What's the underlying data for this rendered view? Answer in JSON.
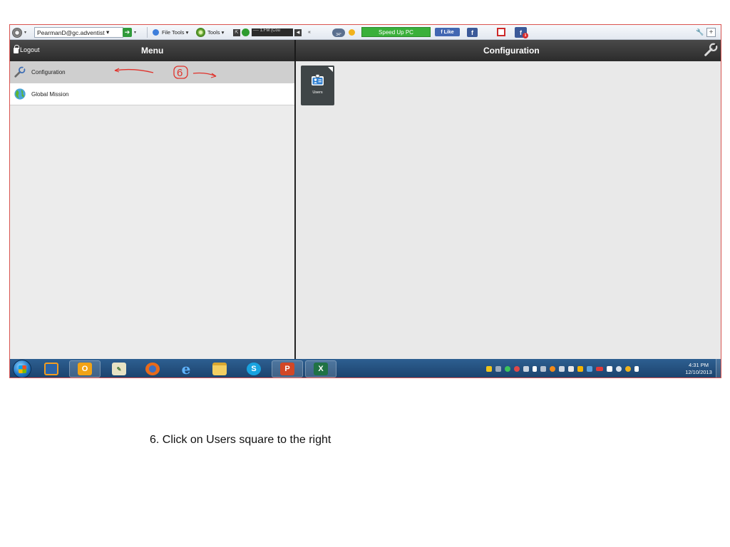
{
  "toolbar": {
    "account_email": "PearmanD@gc.adventist",
    "file_tools_label": "File Tools",
    "tools_label": "Tools",
    "radio_station": "1.FM (Cou",
    "weather_temp": "34°",
    "speed_up_label": "Speed Up PC",
    "fb_like_label": "Like",
    "fb_letter": "f",
    "notify_count": "1",
    "dropdown_arrow": "▾",
    "go_arrow": "➔",
    "back_arrows": "«",
    "plus": "+"
  },
  "app": {
    "logout_label": "Logout",
    "menu_title": "Menu",
    "config_title": "Configuration",
    "menu_items": [
      {
        "label": "Configuration",
        "icon": "wrench-icon",
        "active": true
      },
      {
        "label": "Global Mission",
        "icon": "globe-icon",
        "active": false
      }
    ],
    "tiles": [
      {
        "label": "Users",
        "icon": "user-badge-icon"
      }
    ]
  },
  "annotation": {
    "step_number": "6",
    "color": "#e0322b"
  },
  "taskbar": {
    "apps": [
      "media-player-icon",
      "outlook-icon",
      "notepad-icon",
      "firefox-icon",
      "internet-explorer-icon",
      "file-explorer-icon",
      "skype-icon",
      "powerpoint-icon",
      "excel-icon"
    ],
    "time": "4:31 PM",
    "date": "12/10/2013"
  },
  "caption": "6. Click on Users square to the right",
  "colors": {
    "header_bg": "#2b2b2b",
    "active_menu_bg": "#cfcfcf",
    "tile_bg": "#3f4547",
    "speed_up_green": "#3ab03a",
    "facebook_blue": "#3b5998",
    "taskbar_blue": "#1b416b"
  }
}
